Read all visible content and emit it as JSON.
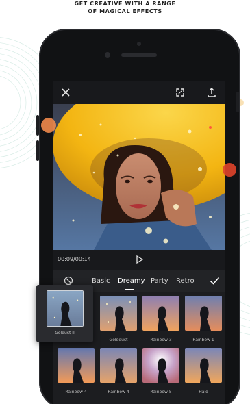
{
  "headline": {
    "line1": "GET CREATIVE WITH A RANGE",
    "line2": "OF MAGICAL EFFECTS"
  },
  "topbar": {
    "icons": [
      "close-icon",
      "fullscreen-icon",
      "share-icon"
    ]
  },
  "player": {
    "timecode": "00:09/00:14",
    "play_icon": "play-icon"
  },
  "filters": {
    "none_icon": "no-filter-icon",
    "tabs": [
      {
        "label": "Basic",
        "active": false
      },
      {
        "label": "Dreamy",
        "active": true
      },
      {
        "label": "Party",
        "active": false
      },
      {
        "label": "Retro",
        "active": false
      }
    ],
    "confirm_icon": "checkmark-icon",
    "selected": {
      "label": "Goldust II"
    },
    "items": [
      {
        "label": "Golddust"
      },
      {
        "label": "Rainbow 3"
      },
      {
        "label": "Rainbow 1"
      },
      {
        "label": "Rainbow 4"
      },
      {
        "label": "Rainbow 4"
      },
      {
        "label": "Rainbow 5"
      },
      {
        "label": "Halo"
      }
    ]
  },
  "colors": {
    "accent_yellow": "#f5c21b",
    "screen_bg": "#18191c",
    "orange_dot": "#f08a4b",
    "red_dot": "#e0442a"
  }
}
